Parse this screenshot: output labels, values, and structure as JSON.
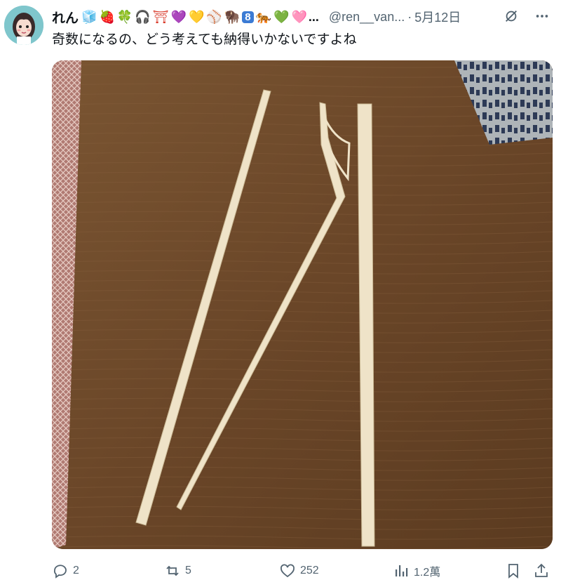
{
  "tweet": {
    "display_name": "れん",
    "name_emojis": [
      "🧊",
      "🍓",
      "🍀",
      "🎧",
      "⛩",
      "💜",
      "💛",
      "⚾",
      "🦬",
      "8",
      "🐅",
      "💚",
      "🩷"
    ],
    "name_ellipsis": "...",
    "handle": "@ren__van...",
    "separator": "·",
    "date": "5月12日",
    "text": "奇数になるの、どう考えても納得いかないですよね"
  },
  "icons": {
    "grok": "grok-slash-icon",
    "more": "more-dots-icon",
    "reply": "reply-icon",
    "retweet": "retweet-icon",
    "like": "heart-icon",
    "views": "views-chart-icon",
    "bookmark": "bookmark-icon",
    "share": "share-icon"
  },
  "stats": {
    "replies": "2",
    "retweets": "5",
    "likes": "252",
    "views": "1.2萬"
  },
  "colors": {
    "text_primary": "#0f1419",
    "text_secondary": "#536471",
    "avatar_bg": "#7fc6cc",
    "table_wood": "#6a4a2e",
    "chopstick": "#efe3c8"
  }
}
